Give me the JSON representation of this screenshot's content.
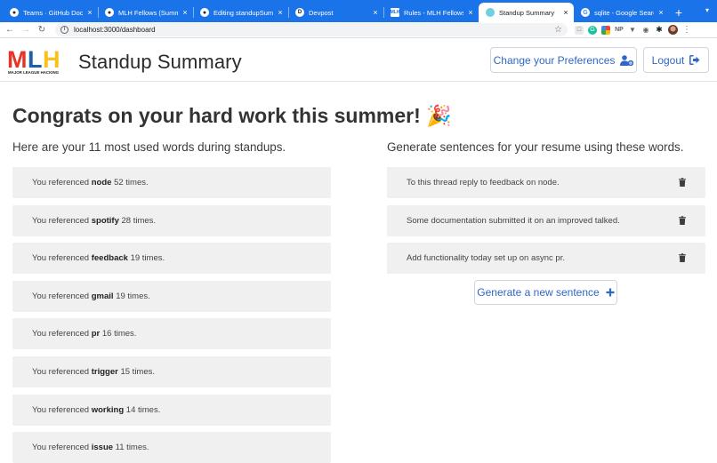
{
  "browser": {
    "tabs": [
      {
        "title": "Teams · GitHub Docs",
        "icon": "github-icon",
        "active": false
      },
      {
        "title": "MLH Fellows (Summer",
        "icon": "github-icon",
        "active": false
      },
      {
        "title": "Editing standupSumm",
        "icon": "github-icon",
        "active": false
      },
      {
        "title": "Devpost",
        "icon": "devpost-icon",
        "active": false
      },
      {
        "title": "Rules - MLH Fellowsh",
        "icon": "mlh-icon",
        "active": false
      },
      {
        "title": "Standup Summary",
        "icon": "standup-summary-icon",
        "active": true
      },
      {
        "title": "sqlite - Google Search",
        "icon": "google-icon",
        "active": false
      }
    ],
    "new_tab": "+",
    "close_glyph": "×",
    "url": "localhost:3000/dashboard",
    "accent": "#1a73e8"
  },
  "header": {
    "logo_text": "MLH",
    "logo_subtext": "MAJOR LEAGUE HACKING",
    "title": "Standup Summary",
    "preferences_button": "Change your Preferences",
    "logout_button": "Logout"
  },
  "main": {
    "headline": "Congrats on your hard work this summer! 🎉",
    "words_heading": "Here are your 11 most used words during standups.",
    "word_prefix": "You referenced ",
    "word_suffix": " times.",
    "words": [
      {
        "word": "node",
        "count": 52
      },
      {
        "word": "spotify",
        "count": 28
      },
      {
        "word": "feedback",
        "count": 19
      },
      {
        "word": "gmail",
        "count": 19
      },
      {
        "word": "pr",
        "count": 16
      },
      {
        "word": "trigger",
        "count": 15
      },
      {
        "word": "working",
        "count": 14
      },
      {
        "word": "issue",
        "count": 11
      }
    ],
    "sentences_heading": "Generate sentences for your resume using these words.",
    "sentences": [
      "To this thread reply to feedback on node.",
      "Some documentation submitted it on an improved talked.",
      "Add functionality today set up on async pr."
    ],
    "generate_button": "Generate a new sentence"
  },
  "colors": {
    "link_blue": "#2f67c6",
    "card_bg": "#f0f0f0",
    "mlh_red": "#e73427",
    "mlh_blue": "#1c5fad",
    "mlh_yellow": "#f7c21d"
  }
}
